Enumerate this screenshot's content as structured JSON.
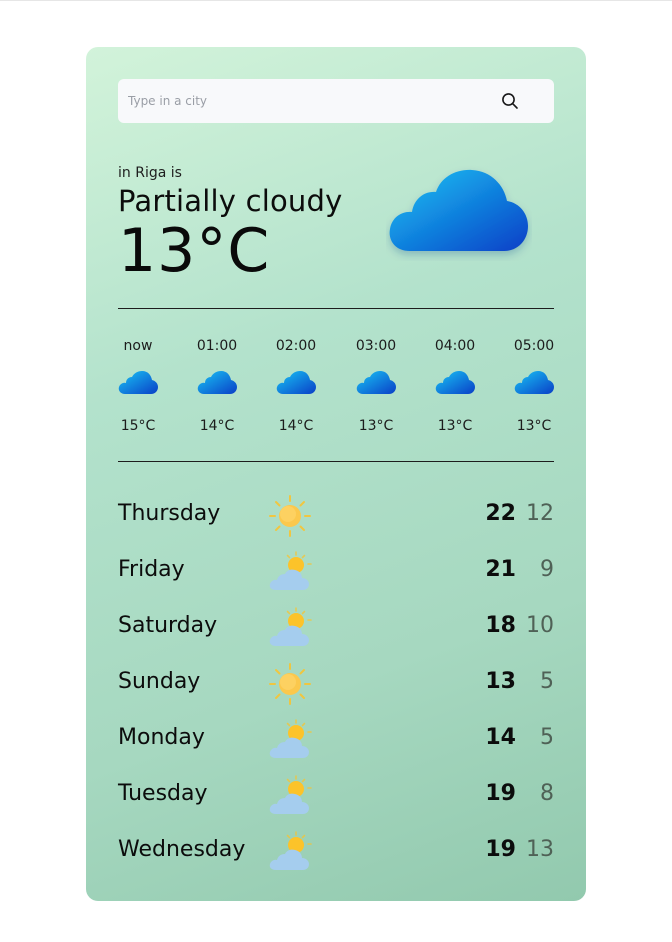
{
  "search": {
    "placeholder": "Type in a city",
    "icon": "search-icon"
  },
  "current": {
    "city_label": "in Riga is",
    "description": "Partially cloudy",
    "temperature": "13°C",
    "icon": "cloud-icon"
  },
  "colors": {
    "card_gradient_start": "#d2f3da",
    "card_gradient_end": "#92c9ae",
    "cloud_gradient_start": "#18c6f5",
    "cloud_gradient_end": "#0a3fc7",
    "sun": "#fcc32a",
    "min_temp_text": "#4f6156"
  },
  "hourly": [
    {
      "time": "now",
      "temp": "15°C",
      "icon": "cloud-icon"
    },
    {
      "time": "01:00",
      "temp": "14°C",
      "icon": "cloud-icon"
    },
    {
      "time": "02:00",
      "temp": "14°C",
      "icon": "cloud-icon"
    },
    {
      "time": "03:00",
      "temp": "13°C",
      "icon": "cloud-icon"
    },
    {
      "time": "04:00",
      "temp": "13°C",
      "icon": "cloud-icon"
    },
    {
      "time": "05:00",
      "temp": "13°C",
      "icon": "cloud-icon"
    }
  ],
  "daily": [
    {
      "day": "Thursday",
      "max": "22",
      "min": "12",
      "icon": "sun-icon"
    },
    {
      "day": "Friday",
      "max": "21",
      "min": "9",
      "icon": "partly-cloudy-icon"
    },
    {
      "day": "Saturday",
      "max": "18",
      "min": "10",
      "icon": "partly-cloudy-icon"
    },
    {
      "day": "Sunday",
      "max": "13",
      "min": "5",
      "icon": "sun-icon"
    },
    {
      "day": "Monday",
      "max": "14",
      "min": "5",
      "icon": "partly-cloudy-icon"
    },
    {
      "day": "Tuesday",
      "max": "19",
      "min": "8",
      "icon": "partly-cloudy-icon"
    },
    {
      "day": "Wednesday",
      "max": "19",
      "min": "13",
      "icon": "partly-cloudy-icon"
    }
  ]
}
